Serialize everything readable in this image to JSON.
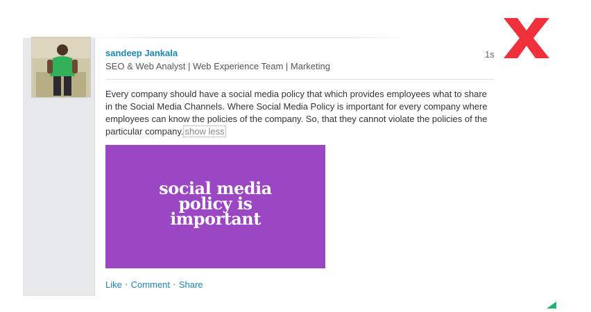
{
  "post": {
    "author_name": "sandeep Jankala",
    "author_headline": "SEO & Web Analyst | Web Experience Team | Marketing",
    "timestamp": "1s",
    "text": "Every company should have a social media policy that which provides employees what to share in the Social Media Channels. Where Social Media Policy is important for every company where employees can know the policies of the company. So, that they cannot violate the policies of the particular company.",
    "show_less_label": "show less",
    "image": {
      "line1": "social media",
      "line2": "policy is",
      "line3": "important",
      "background_color": "#9b46c3"
    },
    "actions": {
      "like": "Like",
      "comment": "Comment",
      "share": "Share",
      "separator": "•"
    }
  },
  "colors": {
    "link_blue": "#1b86b4",
    "close_red": "#f0303a",
    "rail_gray": "#e7e8ea"
  },
  "icons": {
    "close": "close-x-icon",
    "corner": "green-corner-icon"
  }
}
